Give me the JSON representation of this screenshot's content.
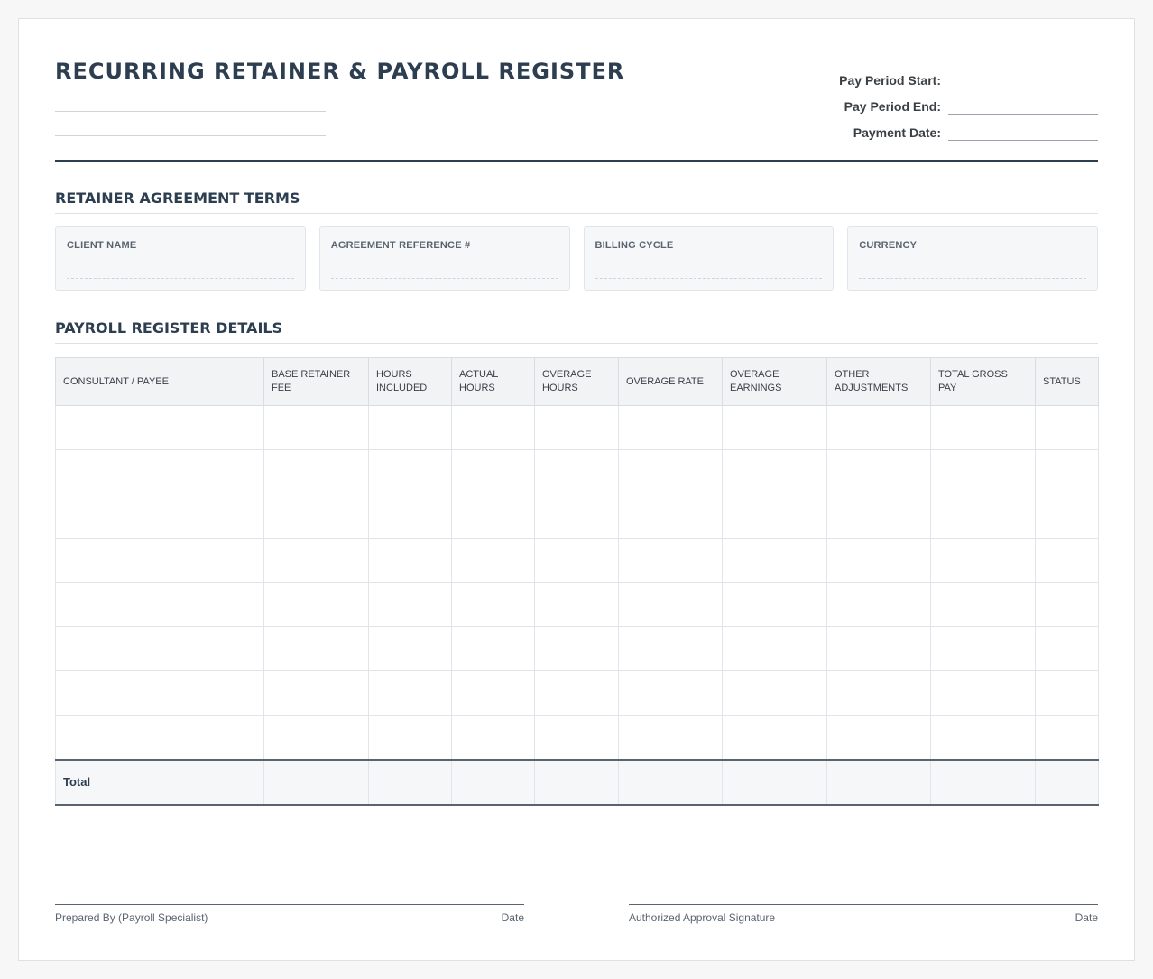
{
  "header": {
    "title": "RECURRING RETAINER & PAYROLL REGISTER",
    "pay_period_start_label": "Pay Period Start:",
    "pay_period_end_label": "Pay Period End:",
    "payment_date_label": "Payment Date:"
  },
  "terms": {
    "section_title": "RETAINER AGREEMENT TERMS",
    "fields": [
      "CLIENT NAME",
      "AGREEMENT REFERENCE #",
      "BILLING CYCLE",
      "CURRENCY"
    ]
  },
  "register": {
    "section_title": "PAYROLL REGISTER DETAILS",
    "columns": [
      [
        "CONSULTANT / PAYEE"
      ],
      [
        "BASE RETAINER FEE"
      ],
      [
        "HOURS",
        "INCLUDED"
      ],
      [
        "ACTUAL",
        "HOURS"
      ],
      [
        "OVERAGE",
        "HOURS"
      ],
      [
        "OVERAGE RATE"
      ],
      [
        "OVERAGE",
        "EARNINGS"
      ],
      [
        "OTHER",
        "ADJUSTMENTS"
      ],
      [
        "TOTAL GROSS PAY"
      ],
      [
        "STATUS"
      ]
    ],
    "total_label": "Total"
  },
  "signatures": {
    "prepared_by": "Prepared By (Payroll Specialist)",
    "date_left": "Date",
    "approval": "Authorized Approval Signature",
    "date_right": "Date"
  }
}
